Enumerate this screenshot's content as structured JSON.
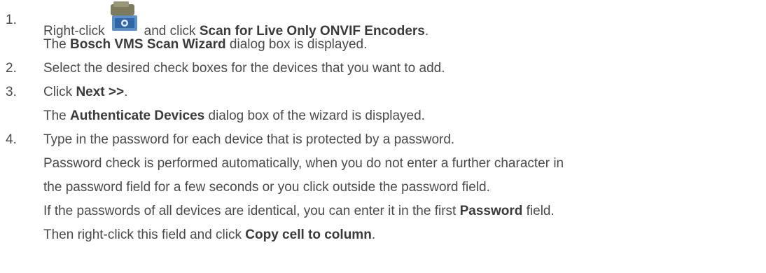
{
  "steps": [
    {
      "number": "1.",
      "line1": {
        "pre": "Right-click",
        "mid": "and click",
        "bold": "Scan for Live Only ONVIF Encoders",
        "post": "."
      },
      "line2": {
        "pre": "The",
        "bold": "Bosch VMS Scan Wizard",
        "post": "dialog box is displayed."
      }
    },
    {
      "number": "2.",
      "line1": {
        "text": "Select the desired check boxes for the devices that you want to add."
      }
    },
    {
      "number": "3.",
      "line1": {
        "pre": "Click",
        "bold": "Next >>",
        "post": "."
      },
      "line2": {
        "pre": "The",
        "bold": "Authenticate Devices",
        "post": "dialog box of the wizard is displayed."
      }
    },
    {
      "number": "4.",
      "line1": {
        "text": "Type in the password for each device that is protected by a password."
      },
      "line2": {
        "text": "Password check is performed automatically, when you do not enter a further character in"
      },
      "line3": {
        "text": "the password field for a few seconds or you click outside the password field."
      },
      "line4": {
        "pre": "If the passwords of all devices are identical, you can enter it in the first",
        "bold": "Password",
        "post": "field."
      },
      "line5": {
        "pre": "Then right-click this field and click",
        "bold": "Copy cell to column",
        "post": "."
      }
    }
  ],
  "icon": {
    "name": "onvif-encoder-icon",
    "color_body": "#8a8a6a",
    "color_screen": "#3a78c8"
  }
}
